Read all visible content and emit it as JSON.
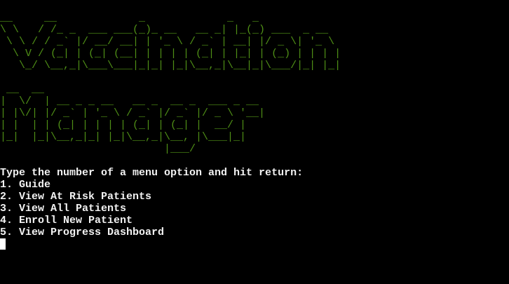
{
  "banner": {
    "title_words": [
      "Vaccination",
      "Manager"
    ],
    "art_vaccination": "__     __             _             _   _             \n\\ \\   / /_ _  ___ ___(_)_ __   __ _| |_(_) ___  _ __  \n \\ \\ / / _` |/ __/ __| | '_ \\ / _` | __| |/ _ \\| '_ \\ \n  \\ V / (_| | (_| (__| | | | | (_| | |_| | (_) | | | |\n   \\_/ \\__,_|\\___\\___|_|_| |_|\\__,_|\\__|_|\\___/|_| |_|",
    "art_manager": " __  __                                   \n|  \\/  | __ _ _ __   __ _  __ _  ___ _ __ \n| |\\/| |/ _` | '_ \\ / _` |/ _` |/ _ \\ '__|\n| |  | | (_| | | | | (_| | (_| |  __/ |   \n|_|  |_|\\__,_|_| |_|\\__,_|\\__, |\\___|_|   \n                          |___/           ",
    "color": "#4f8f16"
  },
  "prompt": "Type the number of a menu option and hit return:",
  "menu": [
    "1. Guide",
    "2. View At Risk Patients",
    "3. View All Patients",
    "4. Enroll New Patient",
    "5. View Progress Dashboard"
  ]
}
